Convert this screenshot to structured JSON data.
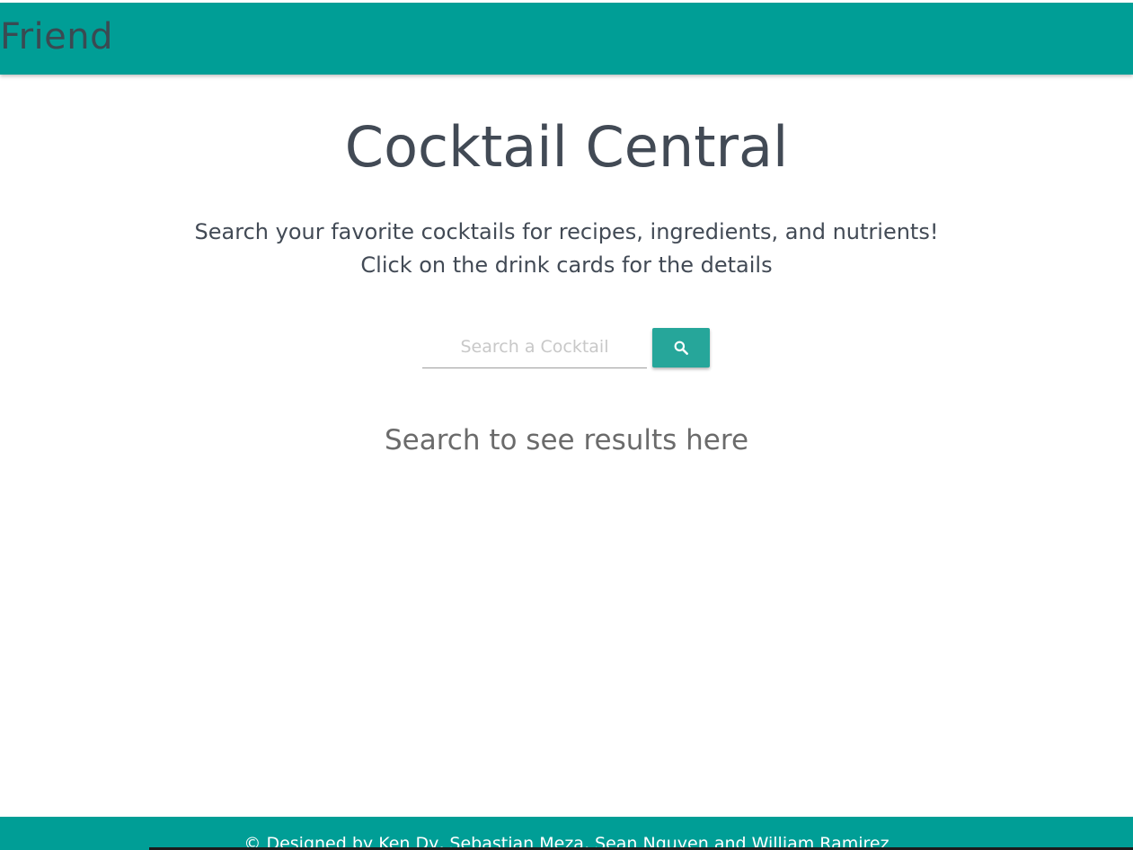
{
  "navbar": {
    "brand": "Friend"
  },
  "main": {
    "title": "Cocktail Central",
    "subtitle_line1": "Search your favorite cocktails for recipes, ingredients, and nutrients!",
    "subtitle_line2": "Click on the drink cards for the details",
    "search": {
      "placeholder": "Search a Cocktail",
      "value": "",
      "button_icon": "search-icon"
    },
    "results_placeholder": "Search to see results here"
  },
  "footer": {
    "text": "© Designed by Ken Dy, Sebastian Meza, Sean Nguyen and William Ramirez"
  },
  "colors": {
    "primary": "#009e96",
    "button": "#26a69a",
    "text": "#424a55"
  }
}
